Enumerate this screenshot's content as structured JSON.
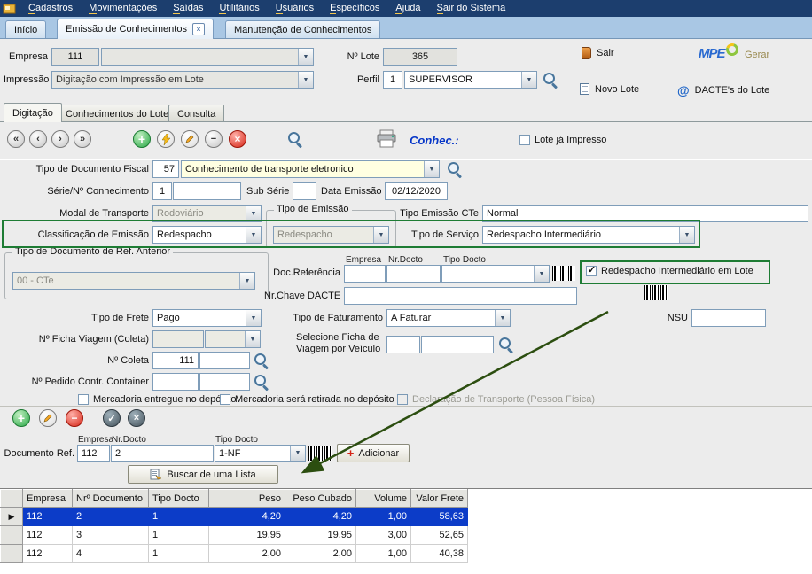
{
  "app": {
    "menu_items": [
      "Cadastros",
      "Movimentações",
      "Saídas",
      "Utilitários",
      "Usuários",
      "Específicos",
      "Ajuda",
      "Sair do Sistema"
    ]
  },
  "tabs": {
    "inicio": "Início",
    "emissao": "Emissão de Conhecimentos",
    "manutencao": "Manutenção de Conhecimentos"
  },
  "header": {
    "empresa_label": "Empresa",
    "empresa_value": "111",
    "lote_label": "Nº Lote",
    "lote_value": "365",
    "impressao_label": "Impressão",
    "impressao_value": "Digitação com Impressão em Lote",
    "perfil_label": "Perfil",
    "perfil_num": "1",
    "perfil_value": "SUPERVISOR",
    "sair_label": "Sair",
    "novo_lote_label": "Novo Lote",
    "gerar_label": "Gerar",
    "dacte_label": "DACTE's do Lote",
    "logo_text": "MPE"
  },
  "subtabs": {
    "digitacao": "Digitação",
    "lote": "Conhecimentos do Lote",
    "consulta": "Consulta"
  },
  "toolbar": {
    "conhec": "Conhec.:",
    "lote_impresso": "Lote já Impresso"
  },
  "form": {
    "tipo_doc_label": "Tipo de Documento Fiscal",
    "tipo_doc_code": "57",
    "tipo_doc_value": "Conhecimento de transporte eletronico",
    "serie_label": "Série/Nº Conhecimento",
    "serie_value": "1",
    "sub_serie_label": "Sub Série",
    "data_emissao_label": "Data Emissão",
    "data_emissao_value": "02/12/2020",
    "modal_label": "Modal de Transporte",
    "modal_value": "Rodoviário",
    "tipo_emissao_group": "Tipo de Emissão",
    "tipo_emissao_value": "Redespacho",
    "tipo_emissao_cte_label": "Tipo Emissão CTe",
    "tipo_emissao_cte_value": "Normal",
    "classificacao_label": "Classificação de Emissão",
    "classificacao_value": "Redespacho",
    "tipo_servico_label": "Tipo de Serviço",
    "tipo_servico_value": "Redespacho Intermediário",
    "ref_anterior_group": "Tipo de Documento de Ref. Anterior",
    "ref_anterior_value": "00 - CTe",
    "doc_ref_label": "Doc.Referência",
    "col_empresa": "Empresa",
    "col_nrdocto": "Nr.Docto",
    "col_tipodocto": "Tipo Docto",
    "redespacho_lote_cb": "Redespacho Intermediário em Lote",
    "chave_dacte_label": "Nr.Chave DACTE",
    "tipo_frete_label": "Tipo de Frete",
    "tipo_frete_value": "Pago",
    "tipo_fat_label": "Tipo de Faturamento",
    "tipo_fat_value": "A Faturar",
    "nsu_label": "NSU",
    "ficha_viagem_label": "Nº Ficha Viagem (Coleta)",
    "selecione_ficha_label": "Selecione Ficha de Viagem por Veículo",
    "coleta_label": "Nº Coleta",
    "coleta_value": "111",
    "pedido_label": "Nº Pedido Contr. Container",
    "cb_entregue": "Mercadoria entregue no depósito",
    "cb_retirada": "Mercadoria será retirada no depósito",
    "cb_declaracao": "Declaração de Transporte (Pessoa Física)"
  },
  "docref": {
    "col_empresa": "Empresa",
    "col_nrdocto": "Nr.Docto",
    "col_tipodocto": "Tipo Docto",
    "label": "Documento Ref.",
    "empresa_value": "112",
    "nrdocto_value": "2",
    "tipodocto_value": "1-NF",
    "adicionar_label": "Adicionar",
    "buscar_label": "Buscar de uma Lista"
  },
  "grid": {
    "headers": [
      "Empresa",
      "Nrº Documento",
      "Tipo Docto",
      "Peso",
      "Peso Cubado",
      "Volume",
      "Valor Frete"
    ],
    "rows": [
      {
        "empresa": "112",
        "nr_documento": "2",
        "tipo_docto": "1",
        "peso": "4,20",
        "peso_cubado": "4,20",
        "volume": "1,00",
        "valor_frete": "58,63"
      },
      {
        "empresa": "112",
        "nr_documento": "3",
        "tipo_docto": "1",
        "peso": "19,95",
        "peso_cubado": "19,95",
        "volume": "3,00",
        "valor_frete": "52,65"
      },
      {
        "empresa": "112",
        "nr_documento": "4",
        "tipo_docto": "1",
        "peso": "2,00",
        "peso_cubado": "2,00",
        "volume": "1,00",
        "valor_frete": "40,38"
      }
    ]
  },
  "icons": {
    "nav_first": "«",
    "nav_prev": "‹",
    "nav_next": "›",
    "nav_last": "»",
    "plus": "+",
    "minus": "−",
    "close": "×",
    "check": "✓",
    "row_pointer": "▶",
    "at": "@",
    "tab_close": "×",
    "adicionar_plus": "+"
  },
  "colors": {
    "menu_bg": "#1c3e6e",
    "tabstrip_bg": "#a9c7e4",
    "highlight_green": "#1e7c34",
    "selection_blue": "#0c3cc8",
    "cream_field": "#ffffe1",
    "conhec_blue": "#0636c8"
  }
}
